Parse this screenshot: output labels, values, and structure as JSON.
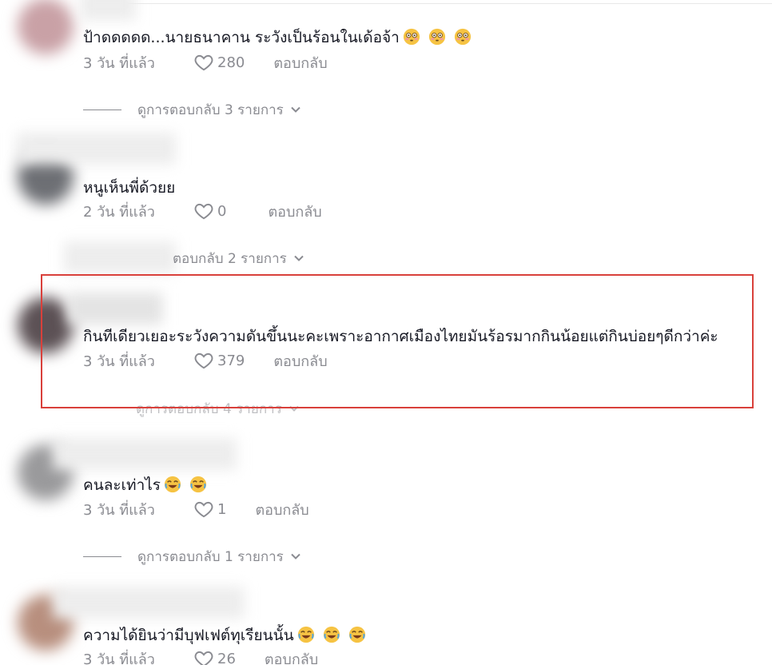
{
  "comments": [
    {
      "text": "ป้าดดดดด...นายธนาคาน ระวังเป็นร้อนในเด้อจ้า",
      "emoji": [
        "flushed-emoji",
        "flushed-emoji",
        "flushed-emoji"
      ],
      "time": "3 วัน ที่แล้ว",
      "likes": "280",
      "reply_label": "ตอบกลับ",
      "view_replies": "ดูการตอบกลับ 3 รายการ"
    },
    {
      "text": "หนูเห็นพี่ด้วยย",
      "emoji": [],
      "time": "2 วัน ที่แล้ว",
      "likes": "0",
      "reply_label": "ตอบกลับ",
      "view_replies": "ตอบกลับ 2 รายการ"
    },
    {
      "text": "กินทีเดียวเยอะระวังความดันขึ้นนะคะเพราะอากาศเมืองไทยมันร้อรมากกินน้อยแต่กินบ่อยๆดีกว่าค่ะ",
      "emoji": [],
      "time": "3 วัน ที่แล้ว",
      "likes": "379",
      "reply_label": "ตอบกลับ",
      "view_replies": "ดูการตอบกลับ 4 รายการ"
    },
    {
      "text": "คนละเท่าไร",
      "emoji": [
        "laughing-emoji",
        "laughing-emoji"
      ],
      "time": "3 วัน ที่แล้ว",
      "likes": "1",
      "reply_label": "ตอบกลับ",
      "view_replies": "ดูการตอบกลับ 1 รายการ"
    },
    {
      "text": "ความได้ยินว่ามีบุฟเฟต์ทุเรียนนั้น",
      "emoji": [
        "laughing-emoji",
        "laughing-emoji",
        "laughing-emoji"
      ],
      "time": "3 วัน ที่แล้ว",
      "likes": "26",
      "reply_label": "ตอบกลับ"
    }
  ],
  "colors": {
    "text": "#161823",
    "muted": "#8a8b91",
    "highlight": "#d9403b"
  }
}
